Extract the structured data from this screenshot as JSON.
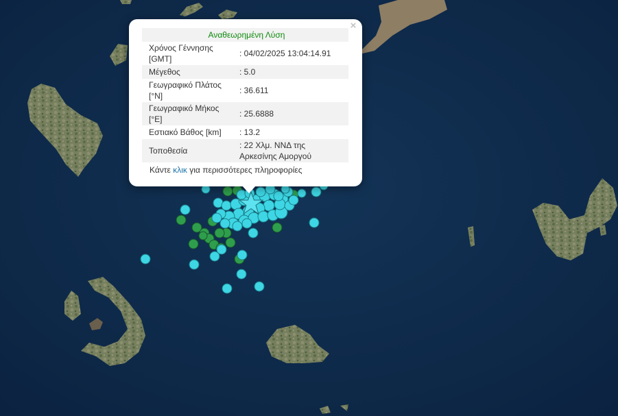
{
  "popup": {
    "header": "Αναθεωρημένη Λύση",
    "close_glyph": "×",
    "rows": [
      {
        "label": "Χρόνος Γέννησης [GMT]",
        "value": ": 04/02/2025 13:04:14.91"
      },
      {
        "label": "Μέγεθος",
        "value": ": 5.0"
      },
      {
        "label": "Γεωγραφικό Πλάτος [°N]",
        "value": ": 36.611"
      },
      {
        "label": "Γεωγραφικό Μήκος [°E]",
        "value": ": 25.6888"
      },
      {
        "label": "Εστιακό Βάθος [km]",
        "value": ": 13.2"
      },
      {
        "label": "Τοποθεσία",
        "value": ": 22 Χλμ. ΝΝΔ της Αρκεσίνης Αμοργού"
      }
    ],
    "more_prefix": "Κάντε",
    "more_link": "κλικ",
    "more_suffix": "για περισσότερες πληροφορίες"
  },
  "colors": {
    "sea": "#0f2a47",
    "land": "#6f7c5b",
    "recent_quake": "#3ed6e4",
    "older_quake": "#2f9e4c",
    "highlight": "#5de2f0",
    "popup_header": "#0d8a0d",
    "link": "#1a73a8"
  },
  "icons": {
    "selected_event": "star-icon",
    "close": "close-icon"
  }
}
